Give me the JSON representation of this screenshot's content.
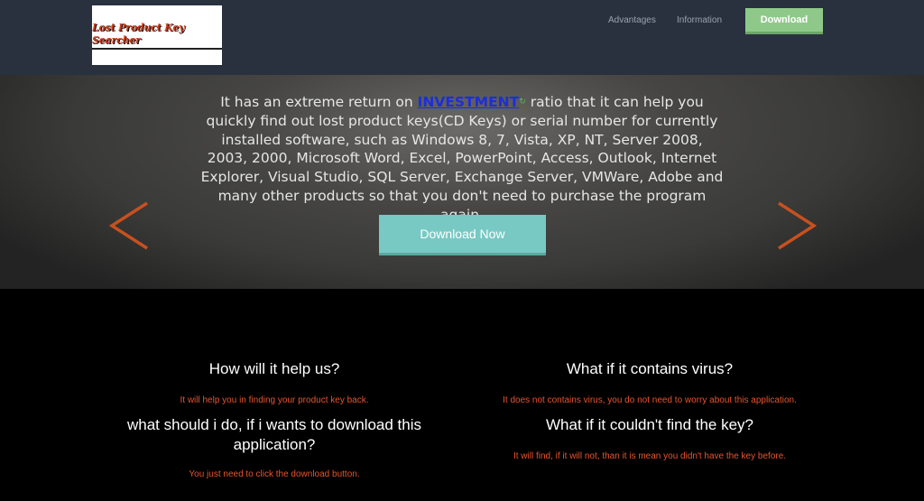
{
  "header": {
    "logo_text": "Lost Product Key Searcher",
    "nav": [
      {
        "label": "Advantages"
      },
      {
        "label": "Information"
      }
    ],
    "download_label": "Download"
  },
  "hero": {
    "text_before_link": "It has an extreme return on ",
    "link_text": "INVESTMENT",
    "text_after_link": " ratio that it can help you quickly find out lost product keys(CD Keys) or serial number for currently installed software, such as Windows 8, 7, Vista, XP, NT, Server 2008, 2003, 2000, Microsoft Word, Excel, PowerPoint, Access, Outlook, Internet Explorer, Visual Studio, SQL Server, Exchange Server, VMWare, Adobe and many other products so that you don't need to purchase the program again.",
    "download_now_label": "Download Now"
  },
  "faq": {
    "left": [
      {
        "q": "How will it help us?",
        "a": "It will help you in finding your product key back."
      },
      {
        "q": "what should i do, if i wants to download this application?",
        "a": "You just need to click the download button."
      }
    ],
    "right": [
      {
        "q": "What if it contains virus?",
        "a": "It does not contains virus, you do not need to worry about this application."
      },
      {
        "q": "What if it couldn't find the key?",
        "a": "It will find, if it will not, than it is mean you didn't have the key before."
      }
    ]
  },
  "colors": {
    "topbar": "#29313f",
    "download_button": "#8fc98a",
    "download_now_button": "#78c9c4",
    "arrow": "#c8501f",
    "answer_text": "#e8542c"
  }
}
